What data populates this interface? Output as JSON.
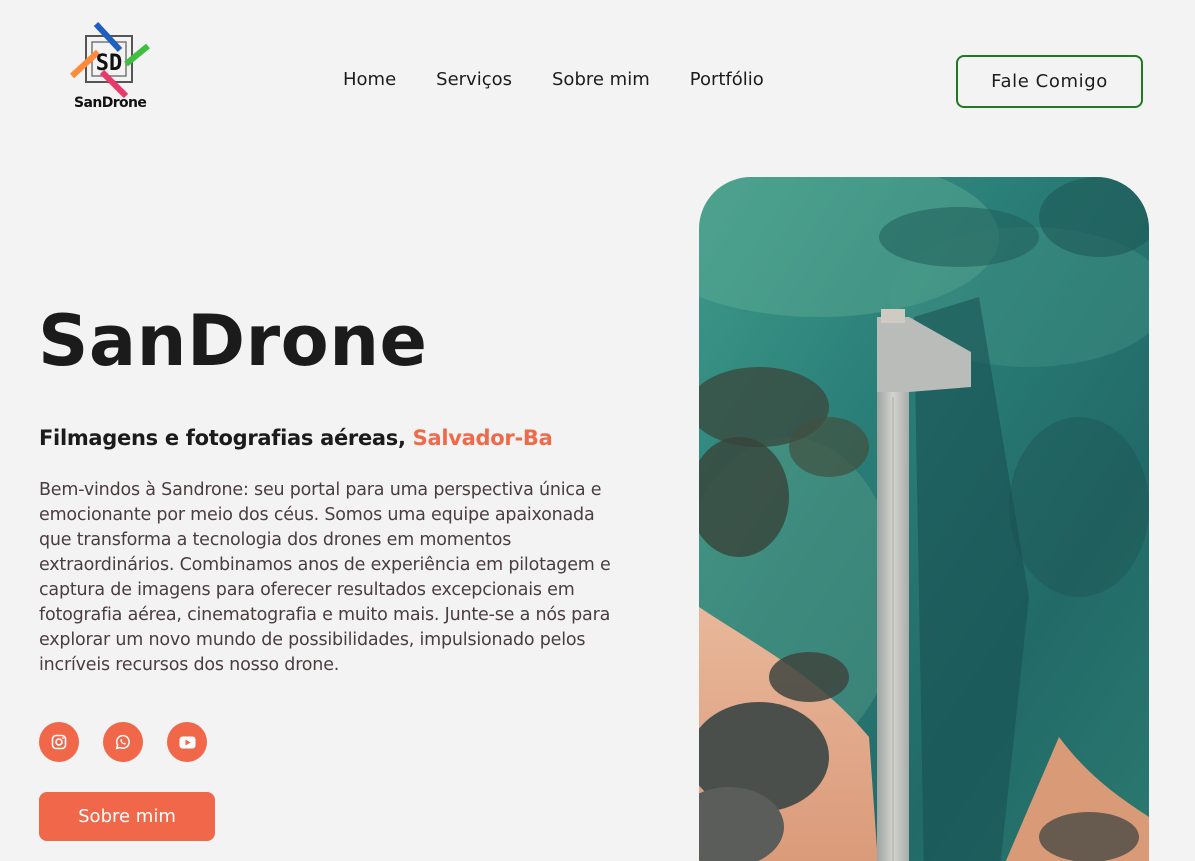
{
  "brand": {
    "logo_mark": "SD",
    "logo_text": "SanDrone"
  },
  "nav": {
    "items": [
      {
        "label": "Home"
      },
      {
        "label": "Serviços"
      },
      {
        "label": "Sobre mim"
      },
      {
        "label": "Portfólio"
      }
    ],
    "cta_label": "Fale Comigo"
  },
  "hero": {
    "title": "SanDrone",
    "subtitle_main": "Filmagens e fotografias aéreas, ",
    "subtitle_accent": "Salvador-Ba",
    "description": "Bem-vindos à Sandrone: seu portal para uma perspectiva única e emocionante por meio dos céus. Somos uma equipe apaixonada que transforma a tecnologia dos drones em momentos extraordinários. Combinamos anos de experiência em pilotagem e captura de imagens para oferecer resultados excepcionais em fotografia aérea, cinematografia e muito mais. Junte-se a nós para explorar um novo mundo de possibilidades, impulsionado pelos incríveis recursos dos nosso drone.",
    "socials": [
      {
        "icon": "instagram-icon"
      },
      {
        "icon": "whatsapp-icon"
      },
      {
        "icon": "youtube-icon"
      }
    ],
    "button_label": "Sobre mim"
  },
  "colors": {
    "accent": "#f0674a",
    "cta_border": "#1f7a1f",
    "background": "#f4f3f3"
  }
}
